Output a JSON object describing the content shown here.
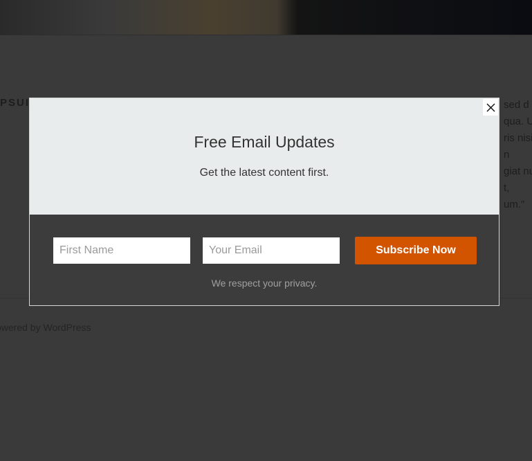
{
  "background": {
    "heading_fragment": "PSUI",
    "quote_fragments": [
      "sed d",
      "qua. U",
      "ris nisi",
      "n",
      "giat nul",
      "t,",
      "um.”"
    ],
    "footer_text": "owered by WordPress"
  },
  "popup": {
    "title": "Free Email Updates",
    "subtitle": "Get the latest content first.",
    "first_name_placeholder": "First Name",
    "email_placeholder": "Your Email",
    "subscribe_label": "Subscribe Now",
    "privacy_text": "We respect your privacy.",
    "close_icon": "close-x-icon",
    "colors": {
      "top_panel": "#e9ecec",
      "bottom_panel": "#3c3c3c",
      "accent": "#d35400",
      "page_overlay": "#3a3a3a"
    }
  }
}
